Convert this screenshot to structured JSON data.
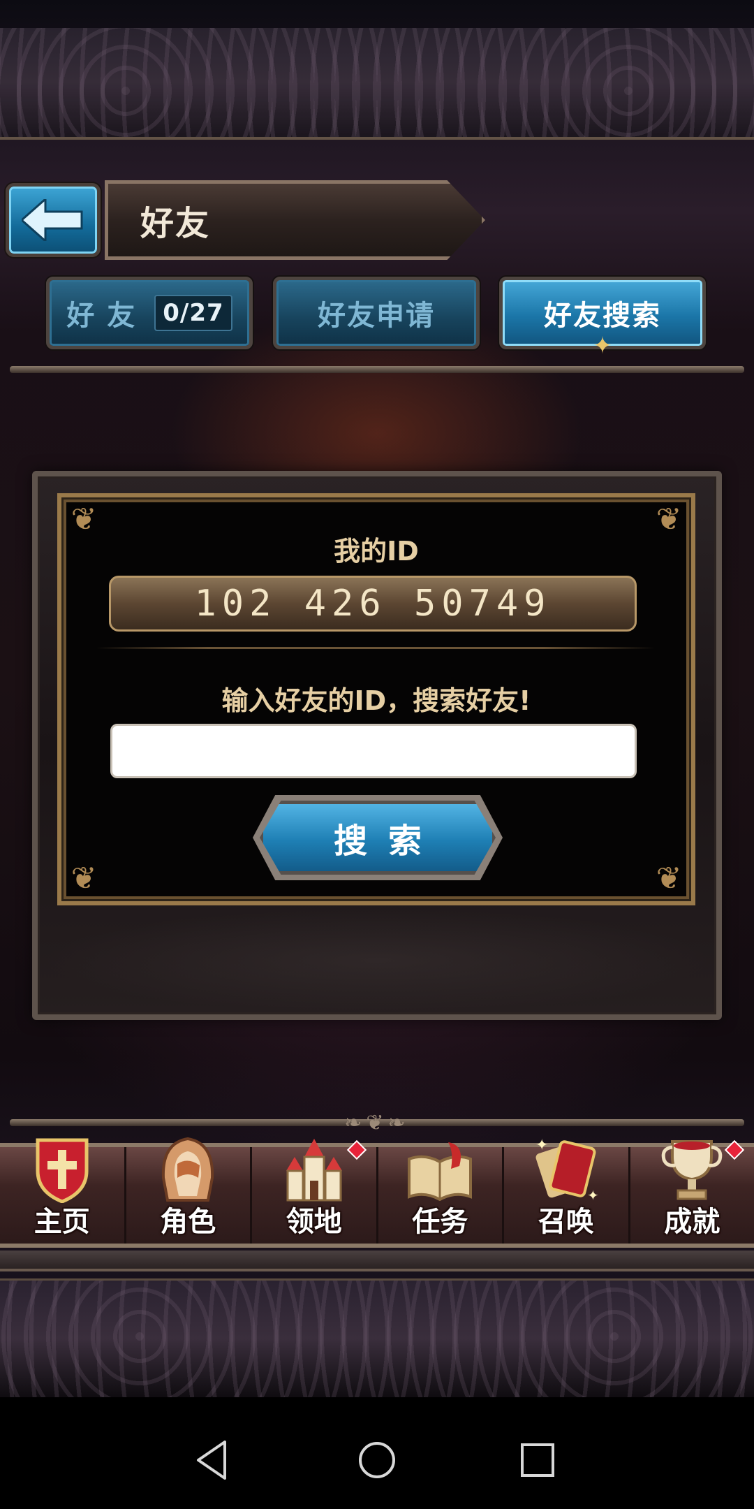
{
  "header": {
    "title": "好友",
    "back_icon": "back-arrow-icon"
  },
  "tabs": [
    {
      "label": "好 友",
      "count": "0/27",
      "active": false
    },
    {
      "label": "好友申请",
      "active": false
    },
    {
      "label": "好友搜索",
      "active": true
    }
  ],
  "search_panel": {
    "my_id_label": "我的ID",
    "my_id_value": "102 426 50749",
    "prompt": "输入好友的ID，搜索好友!",
    "input_value": "",
    "input_placeholder": "",
    "search_button_label": "搜索"
  },
  "bottom_nav": [
    {
      "label": "主页",
      "icon": "shield-cross-icon",
      "badge": false
    },
    {
      "label": "角色",
      "icon": "hooded-character-icon",
      "badge": false
    },
    {
      "label": "领地",
      "icon": "castle-icon",
      "badge": true
    },
    {
      "label": "任务",
      "icon": "quest-book-icon",
      "badge": false
    },
    {
      "label": "召唤",
      "icon": "summon-cards-icon",
      "badge": false
    },
    {
      "label": "成就",
      "icon": "trophy-icon",
      "badge": true
    }
  ],
  "colors": {
    "accent_blue": "#1b76a8",
    "gold_text": "#e6cfa4",
    "badge_red": "#e8233a"
  }
}
